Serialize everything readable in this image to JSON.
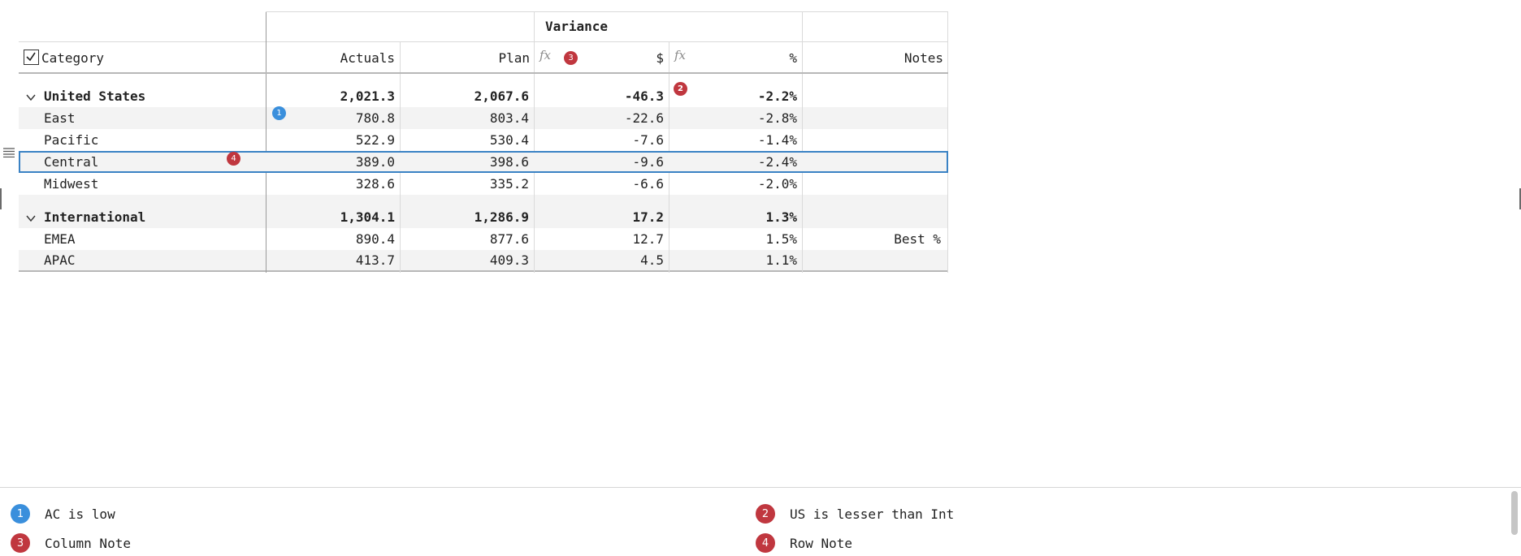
{
  "header": {
    "group_title": "Variance",
    "category_label": "Category",
    "columns": {
      "actuals": "Actuals",
      "plan": "Plan",
      "var_abs": "$",
      "var_pct": "%",
      "notes": "Notes"
    },
    "fx_label": "fx"
  },
  "groups": [
    {
      "name": "United States",
      "actuals": "2,021.3",
      "plan": "2,067.6",
      "var_abs": "-46.3",
      "var_pct": "-2.2%",
      "rows": [
        {
          "name": "East",
          "actuals": "780.8",
          "plan": "803.4",
          "var_abs": "-22.6",
          "var_pct": "-2.8%",
          "note": ""
        },
        {
          "name": "Pacific",
          "actuals": "522.9",
          "plan": "530.4",
          "var_abs": "-7.6",
          "var_pct": "-1.4%",
          "note": ""
        },
        {
          "name": "Central",
          "actuals": "389.0",
          "plan": "398.6",
          "var_abs": "-9.6",
          "var_pct": "-2.4%",
          "note": ""
        },
        {
          "name": "Midwest",
          "actuals": "328.6",
          "plan": "335.2",
          "var_abs": "-6.6",
          "var_pct": "-2.0%",
          "note": ""
        }
      ]
    },
    {
      "name": "International",
      "actuals": "1,304.1",
      "plan": "1,286.9",
      "var_abs": "17.2",
      "var_pct": "1.3%",
      "rows": [
        {
          "name": "EMEA",
          "actuals": "890.4",
          "plan": "877.6",
          "var_abs": "12.7",
          "var_pct": "1.5%",
          "note": "Best %"
        },
        {
          "name": "APAC",
          "actuals": "413.7",
          "plan": "409.3",
          "var_abs": "4.5",
          "var_pct": "1.1%",
          "note": ""
        }
      ]
    }
  ],
  "badges": {
    "b1": "1",
    "b2": "2",
    "b3": "3",
    "b4": "4"
  },
  "notes": [
    {
      "num": "1",
      "text": "AC is low",
      "color": "#3a8fdc"
    },
    {
      "num": "2",
      "text": "US is lesser than Int",
      "color": "#c0373f"
    },
    {
      "num": "3",
      "text": "Column Note",
      "color": "#c0373f"
    },
    {
      "num": "4",
      "text": "Row Note",
      "color": "#c0373f"
    }
  ],
  "colors": {
    "selection": "#3a82c4",
    "badge_blue": "#3a8fdc",
    "badge_red": "#c0373f"
  }
}
